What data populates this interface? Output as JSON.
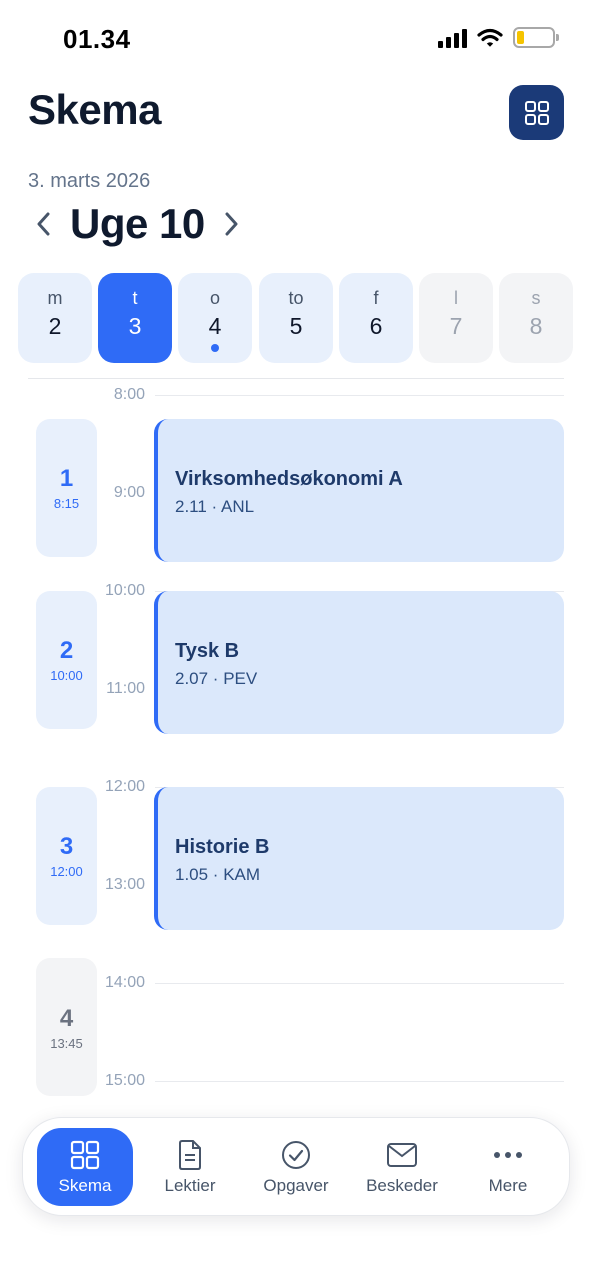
{
  "status_bar": {
    "time": "01.34"
  },
  "header": {
    "title": "Skema",
    "date": "3. marts 2026",
    "week": "Uge 10"
  },
  "days": [
    {
      "name": "m",
      "date": "2",
      "state": "normal"
    },
    {
      "name": "t",
      "date": "3",
      "state": "selected"
    },
    {
      "name": "o",
      "date": "4",
      "state": "today"
    },
    {
      "name": "to",
      "date": "5",
      "state": "normal"
    },
    {
      "name": "f",
      "date": "6",
      "state": "normal"
    },
    {
      "name": "l",
      "date": "7",
      "state": "weekend"
    },
    {
      "name": "s",
      "date": "8",
      "state": "weekend"
    }
  ],
  "timeline": {
    "hours": [
      "8:00",
      "9:00",
      "10:00",
      "11:00",
      "12:00",
      "13:00",
      "14:00",
      "15:00"
    ],
    "periods": [
      {
        "number": "1",
        "time": "8:15"
      },
      {
        "number": "2",
        "time": "10:00"
      },
      {
        "number": "3",
        "time": "12:00"
      },
      {
        "number": "4",
        "time": "13:45"
      }
    ],
    "lessons": [
      {
        "subject": "Virksomhedsøkonomi A",
        "room": "2.11 · ANL"
      },
      {
        "subject": "Tysk B",
        "room": "2.07 · PEV"
      },
      {
        "subject": "Historie B",
        "room": "1.05 · KAM"
      }
    ]
  },
  "tab_bar": {
    "items": [
      {
        "label": "Skema",
        "icon": "grid-icon"
      },
      {
        "label": "Lektier",
        "icon": "document-icon"
      },
      {
        "label": "Opgaver",
        "icon": "check-circle-icon"
      },
      {
        "label": "Beskeder",
        "icon": "mail-icon"
      },
      {
        "label": "Mere",
        "icon": "more-icon"
      }
    ]
  },
  "colors": {
    "accent": "#2f6bf6",
    "accent_dark": "#1b3a78",
    "lesson_bg": "#dbe8fb",
    "day_bg": "#e8f0fc"
  }
}
